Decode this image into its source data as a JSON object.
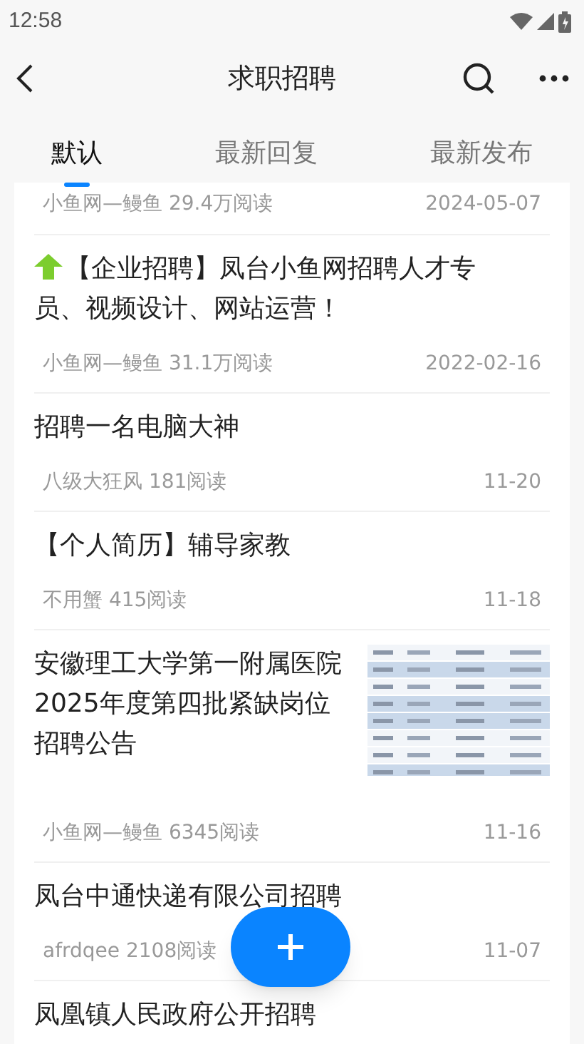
{
  "status_bar": {
    "time": "12:58"
  },
  "header": {
    "title": "求职招聘"
  },
  "tabs": [
    {
      "label": "默认",
      "selected": true
    },
    {
      "label": "最新回复",
      "selected": false
    },
    {
      "label": "最新发布",
      "selected": false
    }
  ],
  "posts": [
    {
      "author_reads": "小鱼网—鳗鱼 29.4万阅读",
      "date": "2024-05-07"
    },
    {
      "title": "【企业招聘】凤台小鱼网招聘人才专员、视频设计、网站运营！",
      "pinned": true,
      "author_reads": "小鱼网—鳗鱼 31.1万阅读",
      "date": "2022-02-16"
    },
    {
      "title": "招聘一名电脑大神",
      "pinned": false,
      "author_reads": "八级大狂风 181阅读",
      "date": "11-20"
    },
    {
      "title": "【个人简历】辅导家教",
      "pinned": false,
      "author_reads": "不用蟹 415阅读",
      "date": "11-18"
    },
    {
      "title": "安徽理工大学第一附属医院2025年度第四批紧缺岗位招聘公告",
      "pinned": false,
      "author_reads": "小鱼网—鳗鱼 6345阅读",
      "date": "11-16"
    },
    {
      "title": "凤台中通快递有限公司招聘",
      "pinned": false,
      "author_reads": "afrdqee 2108阅读",
      "date": "11-07"
    },
    {
      "title": "凤凰镇人民政府公开招聘",
      "pinned": false
    }
  ]
}
